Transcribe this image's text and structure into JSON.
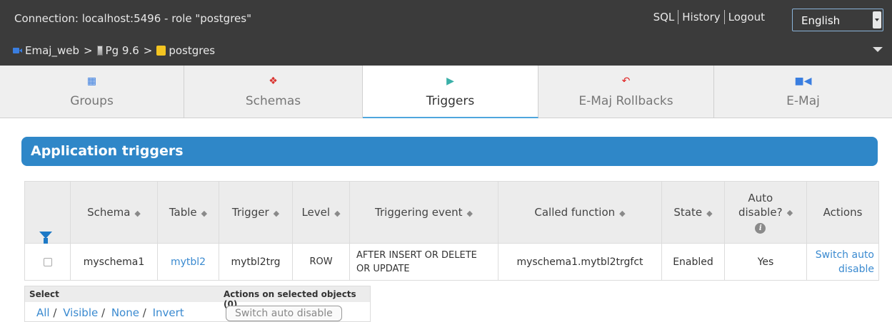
{
  "header": {
    "connection": "Connection: localhost:5496 - role \"postgres\"",
    "links": [
      "SQL",
      "History",
      "Logout"
    ],
    "language": "English",
    "breadcrumb": [
      "Emaj_web",
      "Pg 9.6",
      "postgres"
    ]
  },
  "tabs": [
    {
      "label": "Groups",
      "icon": "groups-icon"
    },
    {
      "label": "Schemas",
      "icon": "schemas-icon"
    },
    {
      "label": "Triggers",
      "icon": "triggers-icon",
      "active": true
    },
    {
      "label": "E-Maj Rollbacks",
      "icon": "rollback-icon"
    },
    {
      "label": "E-Maj",
      "icon": "emaj-icon"
    }
  ],
  "section": {
    "title": "Application triggers"
  },
  "table": {
    "columns": [
      "Schema",
      "Table",
      "Trigger",
      "Level",
      "Triggering event",
      "Called function",
      "State",
      "Auto disable?",
      "Actions"
    ],
    "rows": [
      {
        "schema": "myschema1",
        "table": "mytbl2",
        "trigger": "mytbl2trg",
        "level": "ROW",
        "event": "AFTER INSERT OR DELETE OR UPDATE",
        "function": "myschema1.mytbl2trgfct",
        "state": "Enabled",
        "auto_disable": "Yes",
        "action": "Switch auto disable"
      }
    ]
  },
  "bulk": {
    "select_label": "Select",
    "actions_label": "Actions on selected objects (0)",
    "links": [
      "All",
      "Visible",
      "None",
      "Invert"
    ],
    "button": "Switch auto disable"
  },
  "colors": {
    "accent": "#2f87c8",
    "link": "#3a8ad0",
    "topbar": "#3b3b3b"
  }
}
